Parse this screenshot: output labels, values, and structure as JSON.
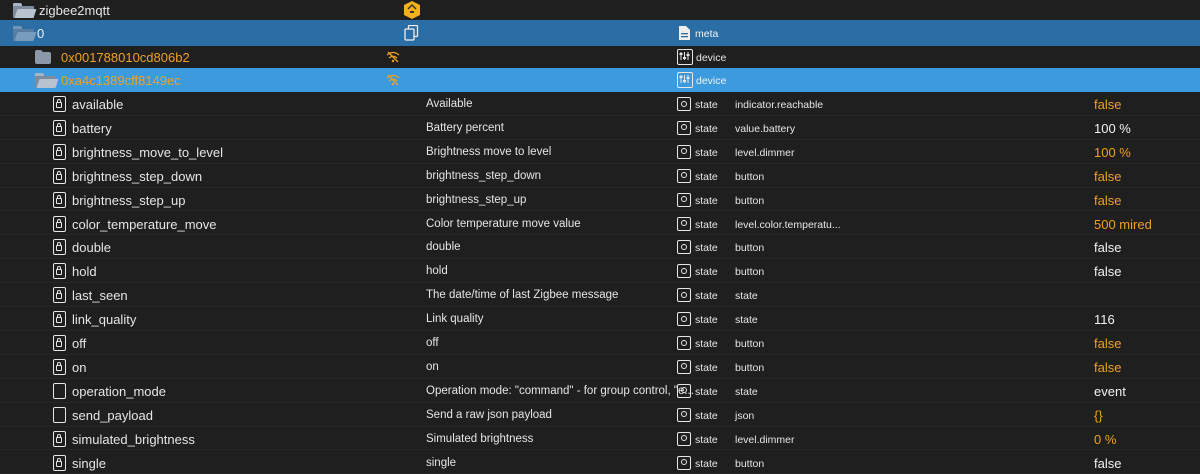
{
  "tree": {
    "root": {
      "label": "zigbee2mqtt"
    },
    "instance": {
      "label": "0",
      "type": "meta"
    },
    "devices": [
      {
        "label": "0x001788010cd806b2",
        "type": "device"
      },
      {
        "label": "0xa4c1389cff8149ec",
        "type": "device"
      }
    ]
  },
  "states": [
    {
      "name": "available",
      "desc": "Available",
      "type": "state",
      "role": "indicator.reachable",
      "value": "false",
      "highlight": true,
      "icon": "lock-doc-icon"
    },
    {
      "name": "battery",
      "desc": "Battery percent",
      "type": "state",
      "role": "value.battery",
      "value": "100 %",
      "highlight": false,
      "icon": "lock-doc-icon"
    },
    {
      "name": "brightness_move_to_level",
      "desc": "Brightness move to level",
      "type": "state",
      "role": "level.dimmer",
      "value": "100 %",
      "highlight": true,
      "icon": "lock-doc-icon"
    },
    {
      "name": "brightness_step_down",
      "desc": "brightness_step_down",
      "type": "state",
      "role": "button",
      "value": "false",
      "highlight": true,
      "icon": "lock-doc-icon"
    },
    {
      "name": "brightness_step_up",
      "desc": "brightness_step_up",
      "type": "state",
      "role": "button",
      "value": "false",
      "highlight": true,
      "icon": "lock-doc-icon"
    },
    {
      "name": "color_temperature_move",
      "desc": "Color temperature move value",
      "type": "state",
      "role": "level.color.temperatu...",
      "value": "500 mired",
      "highlight": true,
      "icon": "lock-doc-icon"
    },
    {
      "name": "double",
      "desc": "double",
      "type": "state",
      "role": "button",
      "value": "false",
      "highlight": false,
      "icon": "lock-doc-icon"
    },
    {
      "name": "hold",
      "desc": "hold",
      "type": "state",
      "role": "button",
      "value": "false",
      "highlight": false,
      "icon": "lock-doc-icon"
    },
    {
      "name": "last_seen",
      "desc": "The date/time of last Zigbee message",
      "type": "state",
      "role": "state",
      "value": "",
      "highlight": false,
      "icon": "lock-doc-icon"
    },
    {
      "name": "link_quality",
      "desc": "Link quality",
      "type": "state",
      "role": "state",
      "value": "116",
      "highlight": false,
      "icon": "lock-doc-icon"
    },
    {
      "name": "off",
      "desc": "off",
      "type": "state",
      "role": "button",
      "value": "false",
      "highlight": true,
      "icon": "lock-doc-icon"
    },
    {
      "name": "on",
      "desc": "on",
      "type": "state",
      "role": "button",
      "value": "false",
      "highlight": true,
      "icon": "lock-doc-icon"
    },
    {
      "name": "operation_mode",
      "desc": "Operation mode: \"command\" - for group control, \"e...",
      "type": "state",
      "role": "state",
      "value": "event",
      "highlight": false,
      "icon": "doc-icon"
    },
    {
      "name": "send_payload",
      "desc": "Send a raw json payload",
      "type": "state",
      "role": "json",
      "value": "{}",
      "highlight": true,
      "icon": "doc-icon"
    },
    {
      "name": "simulated_brightness",
      "desc": "Simulated brightness",
      "type": "state",
      "role": "level.dimmer",
      "value": "0 %",
      "highlight": true,
      "icon": "lock-doc-icon"
    },
    {
      "name": "single",
      "desc": "single",
      "type": "state",
      "role": "button",
      "value": "false",
      "highlight": false,
      "icon": "lock-doc-icon"
    }
  ],
  "colors": {
    "highlight": "#f0a020",
    "selected_row": "#3c9adf",
    "instance_row": "#2b6ea6"
  }
}
